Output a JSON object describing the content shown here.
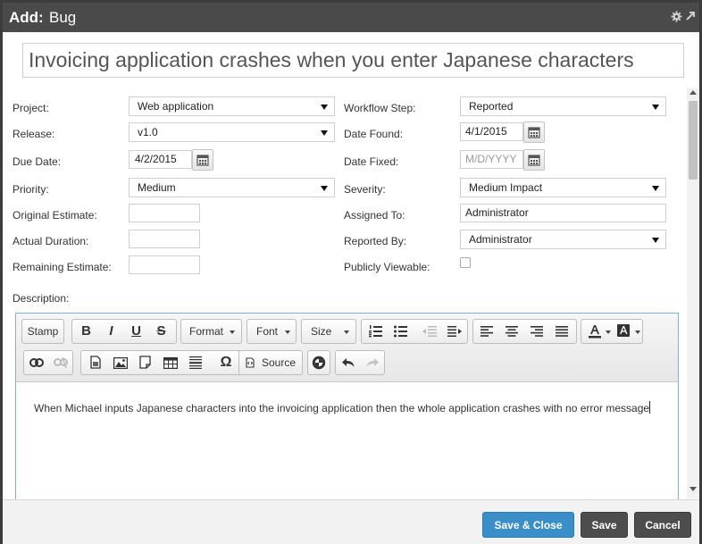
{
  "window": {
    "title_bold": "Add:",
    "title_rest": "Bug",
    "icons": [
      "gear-icon",
      "expand-icon"
    ]
  },
  "title_field": {
    "value": "Invoicing application crashes when you enter Japanese characters"
  },
  "fields": {
    "project": {
      "label": "Project:",
      "value": "Web application"
    },
    "release": {
      "label": "Release:",
      "value": "v1.0"
    },
    "due_date": {
      "label": "Due Date:",
      "value": "4/2/2015"
    },
    "priority": {
      "label": "Priority:",
      "value": "Medium"
    },
    "original_estimate": {
      "label": "Original Estimate:",
      "value": ""
    },
    "actual_duration": {
      "label": "Actual Duration:",
      "value": ""
    },
    "remaining_estimate": {
      "label": "Remaining Estimate:",
      "value": ""
    },
    "workflow_step": {
      "label": "Workflow Step:",
      "value": "Reported"
    },
    "date_found": {
      "label": "Date Found:",
      "value": "4/1/2015"
    },
    "date_fixed": {
      "label": "Date Fixed:",
      "value": "",
      "placeholder": "M/D/YYYY"
    },
    "severity": {
      "label": "Severity:",
      "value": "Medium Impact"
    },
    "assigned_to": {
      "label": "Assigned To:",
      "value": "Administrator"
    },
    "reported_by": {
      "label": "Reported By:",
      "value": "Administrator"
    },
    "publicly_viewable": {
      "label": "Publicly Viewable:",
      "checked": false
    }
  },
  "description": {
    "label": "Description:",
    "toolbar": {
      "stamp": "Stamp",
      "bold": "B",
      "italic": "I",
      "underline": "U",
      "strike": "S",
      "format": "Format",
      "font": "Font",
      "size": "Size",
      "source": "Source",
      "omega": "Ω"
    },
    "body": "When Michael inputs Japanese characters into the invoicing application then the whole application crashes with no error message"
  },
  "footer": {
    "save_close": "Save & Close",
    "save": "Save",
    "cancel": "Cancel"
  },
  "colors": {
    "titlebar": "#4a4a4a",
    "save_close_button": "#3b8fc8",
    "dark_button": "#4d4d4d",
    "editor_border": "#7fb2db"
  }
}
